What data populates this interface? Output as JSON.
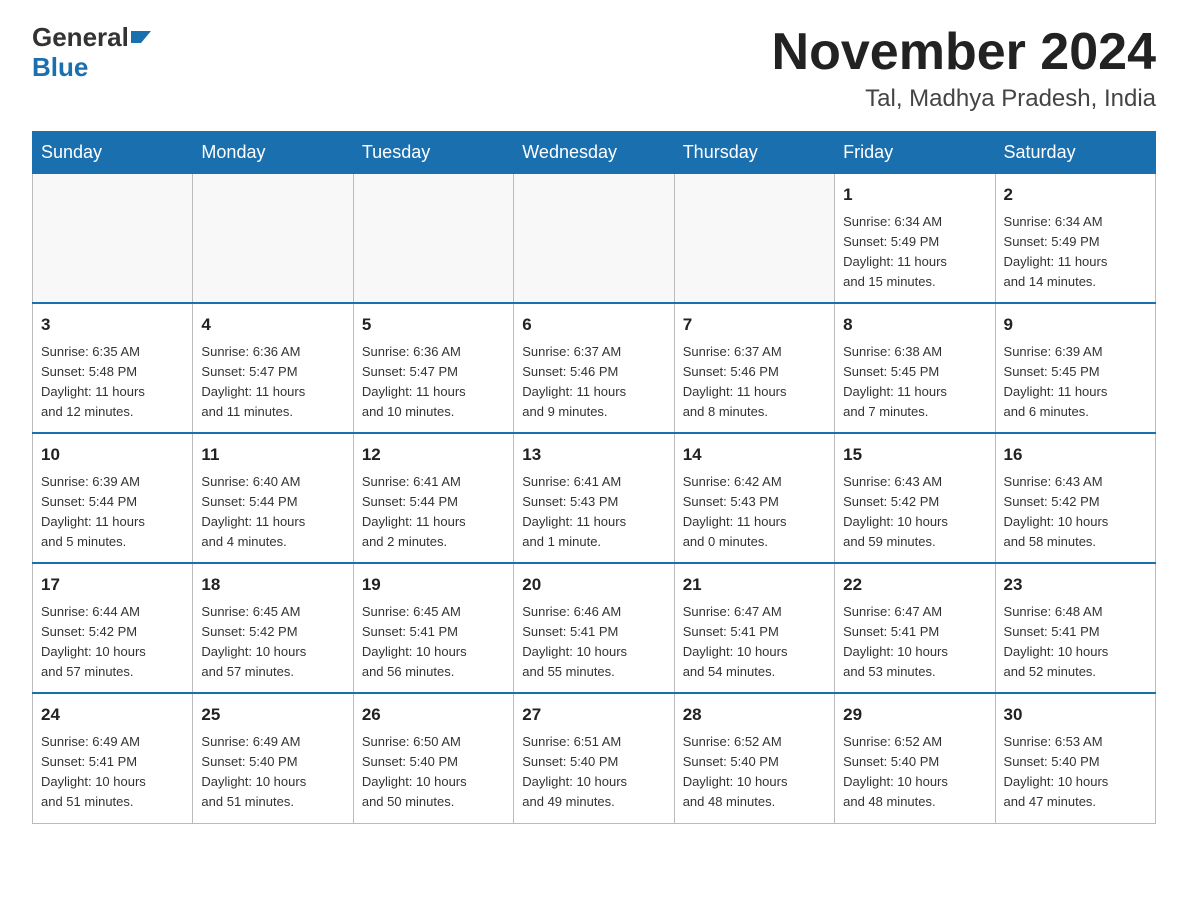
{
  "logo": {
    "general": "General",
    "blue": "Blue"
  },
  "title": "November 2024",
  "location": "Tal, Madhya Pradesh, India",
  "weekdays": [
    "Sunday",
    "Monday",
    "Tuesday",
    "Wednesday",
    "Thursday",
    "Friday",
    "Saturday"
  ],
  "weeks": [
    [
      {
        "day": "",
        "info": ""
      },
      {
        "day": "",
        "info": ""
      },
      {
        "day": "",
        "info": ""
      },
      {
        "day": "",
        "info": ""
      },
      {
        "day": "",
        "info": ""
      },
      {
        "day": "1",
        "info": "Sunrise: 6:34 AM\nSunset: 5:49 PM\nDaylight: 11 hours\nand 15 minutes."
      },
      {
        "day": "2",
        "info": "Sunrise: 6:34 AM\nSunset: 5:49 PM\nDaylight: 11 hours\nand 14 minutes."
      }
    ],
    [
      {
        "day": "3",
        "info": "Sunrise: 6:35 AM\nSunset: 5:48 PM\nDaylight: 11 hours\nand 12 minutes."
      },
      {
        "day": "4",
        "info": "Sunrise: 6:36 AM\nSunset: 5:47 PM\nDaylight: 11 hours\nand 11 minutes."
      },
      {
        "day": "5",
        "info": "Sunrise: 6:36 AM\nSunset: 5:47 PM\nDaylight: 11 hours\nand 10 minutes."
      },
      {
        "day": "6",
        "info": "Sunrise: 6:37 AM\nSunset: 5:46 PM\nDaylight: 11 hours\nand 9 minutes."
      },
      {
        "day": "7",
        "info": "Sunrise: 6:37 AM\nSunset: 5:46 PM\nDaylight: 11 hours\nand 8 minutes."
      },
      {
        "day": "8",
        "info": "Sunrise: 6:38 AM\nSunset: 5:45 PM\nDaylight: 11 hours\nand 7 minutes."
      },
      {
        "day": "9",
        "info": "Sunrise: 6:39 AM\nSunset: 5:45 PM\nDaylight: 11 hours\nand 6 minutes."
      }
    ],
    [
      {
        "day": "10",
        "info": "Sunrise: 6:39 AM\nSunset: 5:44 PM\nDaylight: 11 hours\nand 5 minutes."
      },
      {
        "day": "11",
        "info": "Sunrise: 6:40 AM\nSunset: 5:44 PM\nDaylight: 11 hours\nand 4 minutes."
      },
      {
        "day": "12",
        "info": "Sunrise: 6:41 AM\nSunset: 5:44 PM\nDaylight: 11 hours\nand 2 minutes."
      },
      {
        "day": "13",
        "info": "Sunrise: 6:41 AM\nSunset: 5:43 PM\nDaylight: 11 hours\nand 1 minute."
      },
      {
        "day": "14",
        "info": "Sunrise: 6:42 AM\nSunset: 5:43 PM\nDaylight: 11 hours\nand 0 minutes."
      },
      {
        "day": "15",
        "info": "Sunrise: 6:43 AM\nSunset: 5:42 PM\nDaylight: 10 hours\nand 59 minutes."
      },
      {
        "day": "16",
        "info": "Sunrise: 6:43 AM\nSunset: 5:42 PM\nDaylight: 10 hours\nand 58 minutes."
      }
    ],
    [
      {
        "day": "17",
        "info": "Sunrise: 6:44 AM\nSunset: 5:42 PM\nDaylight: 10 hours\nand 57 minutes."
      },
      {
        "day": "18",
        "info": "Sunrise: 6:45 AM\nSunset: 5:42 PM\nDaylight: 10 hours\nand 57 minutes."
      },
      {
        "day": "19",
        "info": "Sunrise: 6:45 AM\nSunset: 5:41 PM\nDaylight: 10 hours\nand 56 minutes."
      },
      {
        "day": "20",
        "info": "Sunrise: 6:46 AM\nSunset: 5:41 PM\nDaylight: 10 hours\nand 55 minutes."
      },
      {
        "day": "21",
        "info": "Sunrise: 6:47 AM\nSunset: 5:41 PM\nDaylight: 10 hours\nand 54 minutes."
      },
      {
        "day": "22",
        "info": "Sunrise: 6:47 AM\nSunset: 5:41 PM\nDaylight: 10 hours\nand 53 minutes."
      },
      {
        "day": "23",
        "info": "Sunrise: 6:48 AM\nSunset: 5:41 PM\nDaylight: 10 hours\nand 52 minutes."
      }
    ],
    [
      {
        "day": "24",
        "info": "Sunrise: 6:49 AM\nSunset: 5:41 PM\nDaylight: 10 hours\nand 51 minutes."
      },
      {
        "day": "25",
        "info": "Sunrise: 6:49 AM\nSunset: 5:40 PM\nDaylight: 10 hours\nand 51 minutes."
      },
      {
        "day": "26",
        "info": "Sunrise: 6:50 AM\nSunset: 5:40 PM\nDaylight: 10 hours\nand 50 minutes."
      },
      {
        "day": "27",
        "info": "Sunrise: 6:51 AM\nSunset: 5:40 PM\nDaylight: 10 hours\nand 49 minutes."
      },
      {
        "day": "28",
        "info": "Sunrise: 6:52 AM\nSunset: 5:40 PM\nDaylight: 10 hours\nand 48 minutes."
      },
      {
        "day": "29",
        "info": "Sunrise: 6:52 AM\nSunset: 5:40 PM\nDaylight: 10 hours\nand 48 minutes."
      },
      {
        "day": "30",
        "info": "Sunrise: 6:53 AM\nSunset: 5:40 PM\nDaylight: 10 hours\nand 47 minutes."
      }
    ]
  ]
}
